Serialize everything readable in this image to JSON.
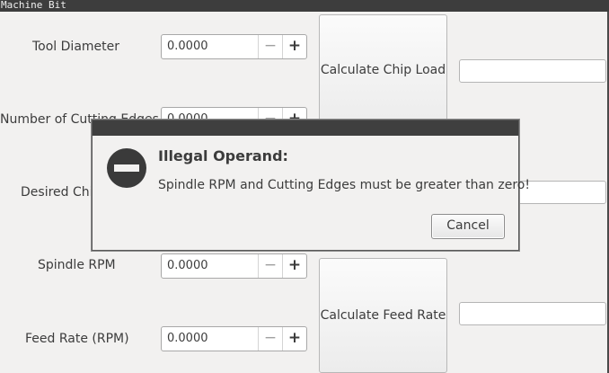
{
  "window": {
    "title": "Machine Bit"
  },
  "fields": {
    "tool_diameter": {
      "label": "Tool Diameter",
      "value": "0.0000"
    },
    "cutting_edges": {
      "label": "Number of Cutting Edges",
      "value": "0.0000"
    },
    "desired_chip": {
      "label": "Desired Chip",
      "value": ""
    },
    "spindle_rpm": {
      "label": "Spindle RPM",
      "value": "0.0000"
    },
    "feed_rate": {
      "label": "Feed Rate (RPM)",
      "value": "0.0000"
    }
  },
  "spin": {
    "minus": "−",
    "plus": "+"
  },
  "buttons": {
    "calc_chip_load": "Calculate Chip Load",
    "calc_feed_rate": "Calculate Feed Rate"
  },
  "results": {
    "chip_load": "",
    "desired_chip": "",
    "feed_rate": ""
  },
  "dialog": {
    "title": "Illegal Operand:",
    "message": "Spindle RPM and Cutting Edges must be greater than zero!",
    "cancel": "Cancel",
    "icon": "stop-icon"
  }
}
